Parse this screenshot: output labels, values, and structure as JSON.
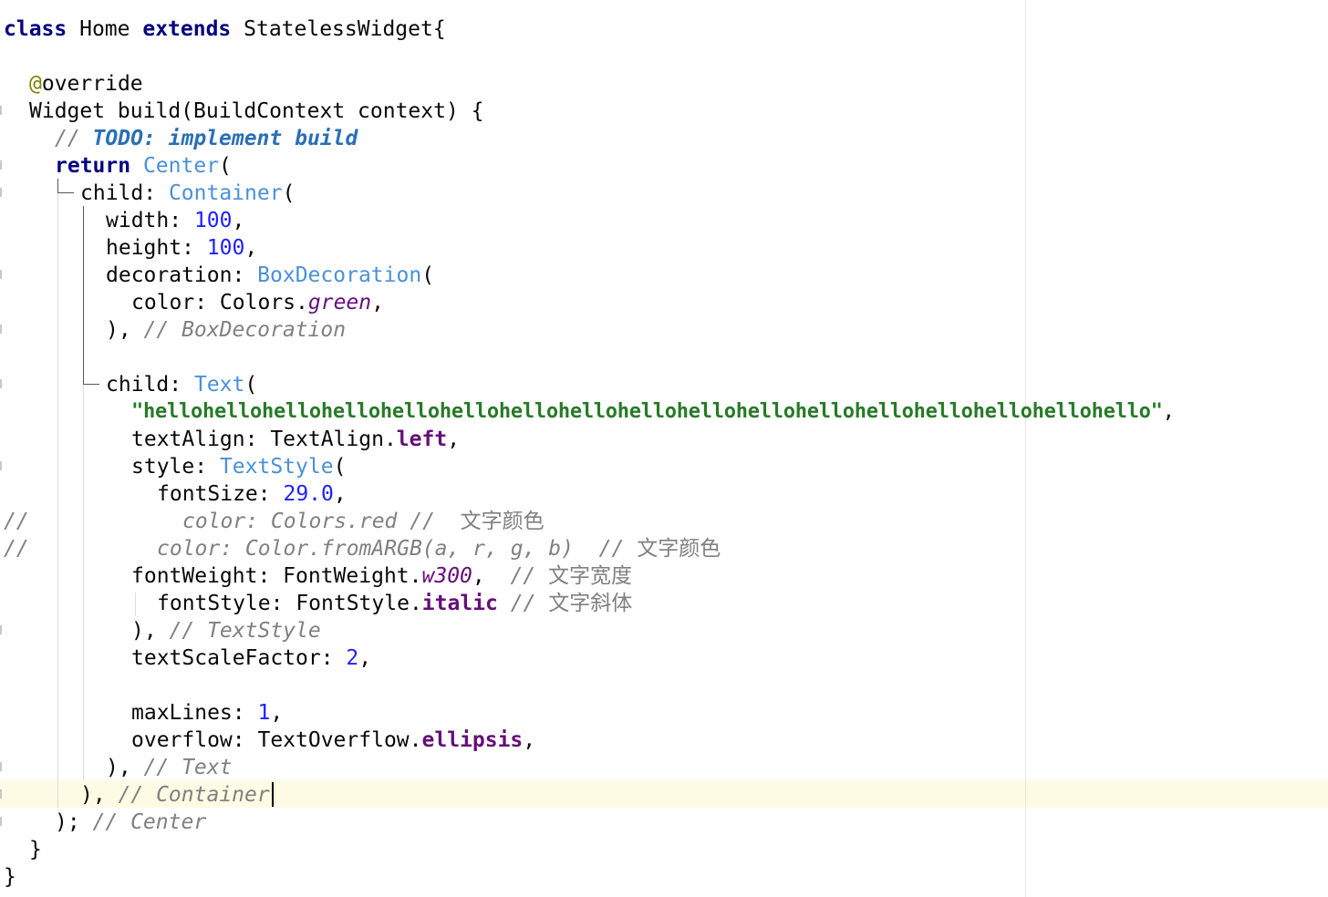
{
  "editor": {
    "language": "Dart",
    "colors": {
      "keyword": "#000080",
      "annotation": "#808000",
      "class": "#4a90d9",
      "number": "#1f1fff",
      "string": "#287a28",
      "field": "#660e7a",
      "comment": "#808080",
      "todo": "#2a6fb5",
      "current_line": "#fdfbe3"
    },
    "current_line": 29,
    "lines": {
      "l1": {
        "kw1": "class",
        "t1": " Home ",
        "kw2": "extends",
        "t2": " StatelessWidget{"
      },
      "l3": {
        "ann": "@",
        "t1": "override"
      },
      "l4": {
        "t1": "Widget build(BuildContext context) {"
      },
      "l5": {
        "cmt": "// ",
        "todo": "TODO: implement build"
      },
      "l6": {
        "kw1": "return",
        "t1": " ",
        "cls": "Center",
        "t2": "("
      },
      "l7": {
        "t1": "child: ",
        "cls": "Container",
        "t2": "("
      },
      "l8": {
        "t1": "width: ",
        "num": "100",
        "t2": ","
      },
      "l9": {
        "t1": "height: ",
        "num": "100",
        "t2": ","
      },
      "l10": {
        "t1": "decoration: ",
        "cls": "BoxDecoration",
        "t2": "("
      },
      "l11": {
        "t1": "color: Colors.",
        "fld": "green",
        "t2": ","
      },
      "l12": {
        "t1": "), ",
        "cmt": "// BoxDecoration"
      },
      "l14": {
        "t1": "child: ",
        "cls": "Text",
        "t2": "("
      },
      "l15": {
        "str": "\"hellohellohellohellohellohellohellohellohellohellohellohellohellohellohellohellohello\"",
        "t1": ","
      },
      "l16": {
        "t1": "textAlign: TextAlign.",
        "fld": "left",
        "t2": ","
      },
      "l17": {
        "t1": "style: ",
        "cls": "TextStyle",
        "t2": "("
      },
      "l18": {
        "t1": "fontSize: ",
        "num": "29.0",
        "t2": ","
      },
      "l19": {
        "prefix": "//",
        "cmt": "color: Colors.red //  ",
        "cn": "文字颜色"
      },
      "l20": {
        "prefix": "//",
        "cmt": "color: Color.fromARGB(a, r, g, b)  // ",
        "cn": "文字颜色"
      },
      "l21": {
        "t1": "fontWeight: FontWeight.",
        "fld": "w300",
        "t2": ",  ",
        "cmt": "// ",
        "cn": "文字宽度"
      },
      "l22": {
        "t1": "fontStyle: FontStyle.",
        "fld": "italic",
        "t2": " ",
        "cmt": "// ",
        "cn": "文字斜体"
      },
      "l23": {
        "t1": "), ",
        "cmt": "// TextStyle"
      },
      "l24": {
        "t1": "textScaleFactor: ",
        "num": "2",
        "t2": ","
      },
      "l26": {
        "t1": "maxLines: ",
        "num": "1",
        "t2": ","
      },
      "l27": {
        "t1": "overflow: TextOverflow.",
        "fld": "ellipsis",
        "t2": ","
      },
      "l28": {
        "t1": "), ",
        "cmt": "// Text"
      },
      "l29": {
        "t1": "), ",
        "cmt": "// Container"
      },
      "l30": {
        "t1": "); ",
        "cmt": "// Center"
      },
      "l31": {
        "t1": "}"
      },
      "l32": {
        "t1": "}"
      }
    }
  }
}
